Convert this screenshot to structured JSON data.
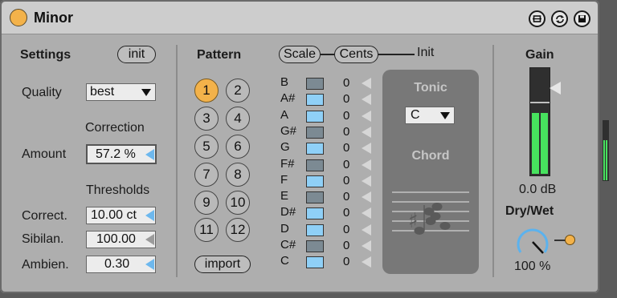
{
  "device": {
    "title": "Minor"
  },
  "settings": {
    "heading": "Settings",
    "init_label": "init",
    "quality_label": "Quality",
    "quality_value": "best",
    "correction_label": "Correction",
    "amount_label": "Amount",
    "amount_value": "57.2 %",
    "thresholds_label": "Thresholds",
    "correct_label": "Correct.",
    "correct_value": "10.00 ct",
    "sibilan_label": "Sibilan.",
    "sibilan_value": "100.00",
    "ambien_label": "Ambien.",
    "ambien_value": "0.30"
  },
  "pattern": {
    "heading": "Pattern",
    "buttons": [
      "1",
      "2",
      "3",
      "4",
      "5",
      "6",
      "7",
      "8",
      "9",
      "10",
      "11",
      "12"
    ],
    "active": "1",
    "import_label": "import"
  },
  "scale": {
    "scale_label": "Scale",
    "cents_label": "Cents",
    "init_label": "Init",
    "notes": [
      {
        "name": "B",
        "active": false,
        "cents": "0"
      },
      {
        "name": "A#",
        "active": true,
        "cents": "0"
      },
      {
        "name": "A",
        "active": true,
        "cents": "0"
      },
      {
        "name": "G#",
        "active": false,
        "cents": "0"
      },
      {
        "name": "G",
        "active": true,
        "cents": "0"
      },
      {
        "name": "F#",
        "active": false,
        "cents": "0"
      },
      {
        "name": "F",
        "active": true,
        "cents": "0"
      },
      {
        "name": "E",
        "active": false,
        "cents": "0"
      },
      {
        "name": "D#",
        "active": true,
        "cents": "0"
      },
      {
        "name": "D",
        "active": true,
        "cents": "0"
      },
      {
        "name": "C#",
        "active": false,
        "cents": "0"
      },
      {
        "name": "C",
        "active": true,
        "cents": "0"
      }
    ]
  },
  "tonic": {
    "label": "Tonic",
    "value": "C",
    "chord_label": "Chord"
  },
  "output": {
    "gain_label": "Gain",
    "gain_value": "0.0 dB",
    "drywet_label": "Dry/Wet",
    "drywet_value": "100 %",
    "drywet_level": 1.0
  },
  "colors": {
    "accent": "#f3b24a",
    "active_note": "#8fd0f7",
    "inactive_note": "#7c8a93",
    "meter": "#47e25e",
    "knob": "#5bb2ee"
  }
}
